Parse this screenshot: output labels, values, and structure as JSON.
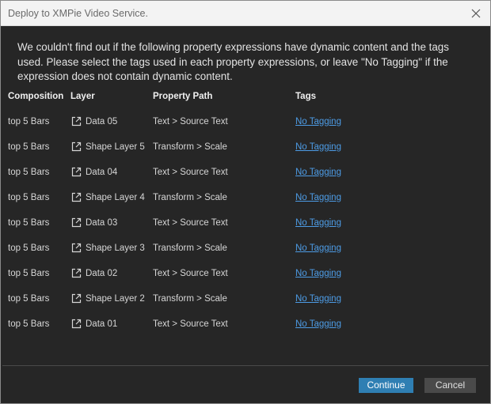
{
  "window": {
    "title": "Deploy to XMPie Video Service."
  },
  "message": "We couldn't find out if the following property expressions have dynamic content and the tags used. Please select the tags used in each property expressions, or leave \"No Tagging\" if the expression does not contain dynamic content.",
  "table": {
    "headers": {
      "composition": "Composition",
      "layer": "Layer",
      "property_path": "Property Path",
      "tags": "Tags"
    },
    "rows": [
      {
        "composition": "top 5 Bars",
        "layer": "Data 05",
        "property_path": "Text > Source Text",
        "tags": "No Tagging"
      },
      {
        "composition": "top 5 Bars",
        "layer": "Shape Layer 5",
        "property_path": "Transform > Scale",
        "tags": "No Tagging"
      },
      {
        "composition": "top 5 Bars",
        "layer": "Data 04",
        "property_path": "Text > Source Text",
        "tags": "No Tagging"
      },
      {
        "composition": "top 5 Bars",
        "layer": "Shape Layer 4",
        "property_path": "Transform > Scale",
        "tags": "No Tagging"
      },
      {
        "composition": "top 5 Bars",
        "layer": "Data 03",
        "property_path": "Text > Source Text",
        "tags": "No Tagging"
      },
      {
        "composition": "top 5 Bars",
        "layer": "Shape Layer 3",
        "property_path": "Transform > Scale",
        "tags": "No Tagging"
      },
      {
        "composition": "top 5 Bars",
        "layer": "Data 02",
        "property_path": "Text > Source Text",
        "tags": "No Tagging"
      },
      {
        "composition": "top 5 Bars",
        "layer": "Shape Layer 2",
        "property_path": "Transform > Scale",
        "tags": "No Tagging"
      },
      {
        "composition": "top 5 Bars",
        "layer": "Data 01",
        "property_path": "Text > Source Text",
        "tags": "No Tagging"
      }
    ]
  },
  "buttons": {
    "continue": "Continue",
    "cancel": "Cancel"
  },
  "icons": {
    "close": "close-icon",
    "layer_link": "external-link-icon"
  },
  "colors": {
    "background": "#262626",
    "titlebar": "#f3f3f3",
    "link": "#4d9ce6",
    "primary_button": "#2f7fb3",
    "secondary_button": "#4a4a4a"
  }
}
